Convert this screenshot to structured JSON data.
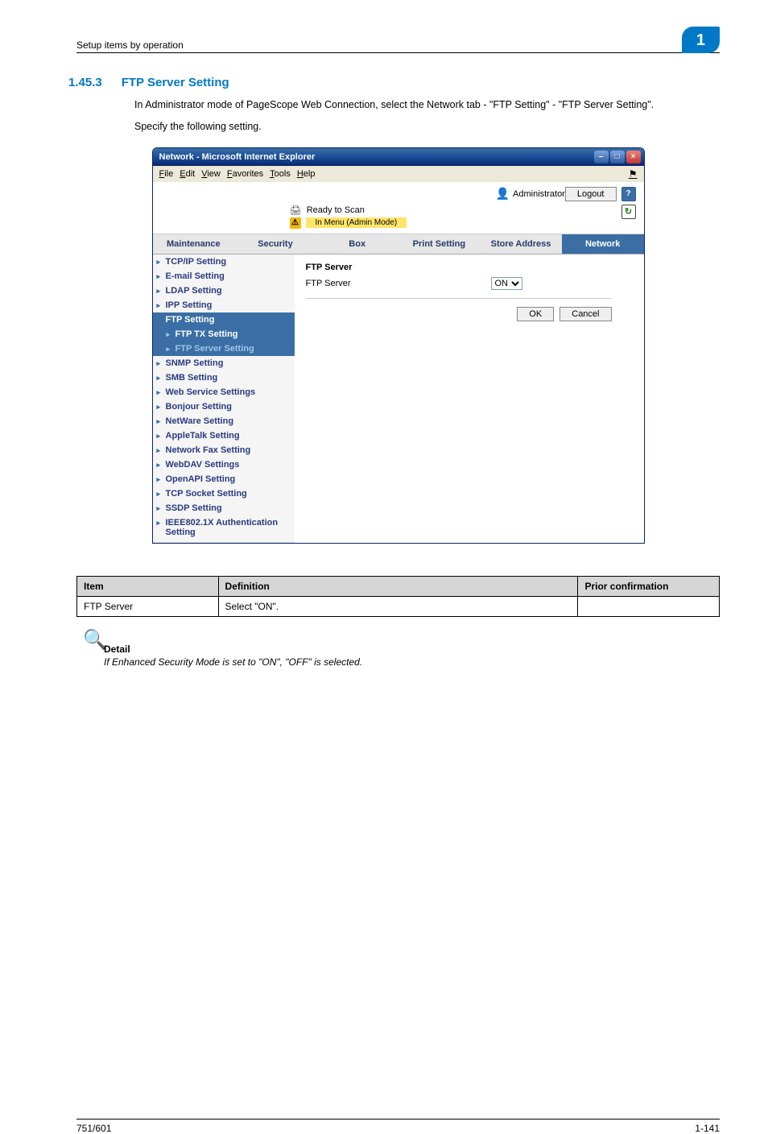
{
  "header": {
    "section_path": "Setup items by operation",
    "chapter_badge": "1"
  },
  "section": {
    "number": "1.45.3",
    "title": "FTP Server Setting",
    "para1": "In Administrator mode of PageScope Web Connection, select the Network tab - \"FTP Setting\" - \"FTP Server Setting\".",
    "para2": "Specify the following setting."
  },
  "window": {
    "title": "Network - Microsoft Internet Explorer",
    "menu": {
      "file": "File",
      "edit": "Edit",
      "view": "View",
      "favorites": "Favorites",
      "tools": "Tools",
      "help": "Help"
    },
    "admin_label": "Administrator",
    "logout": "Logout",
    "help_glyph": "?",
    "status": {
      "ready": "Ready to Scan",
      "mode": "In Menu (Admin Mode)"
    },
    "tabs": {
      "maintenance": "Maintenance",
      "security": "Security",
      "box": "Box",
      "print": "Print Setting",
      "store": "Store Address",
      "network": "Network"
    },
    "sidenav": {
      "tcpip": "TCP/IP Setting",
      "email": "E-mail Setting",
      "ldap": "LDAP Setting",
      "ipp": "IPP Setting",
      "ftp": "FTP Setting",
      "ftp_tx": "FTP TX Setting",
      "ftp_server": "FTP Server Setting",
      "snmp": "SNMP Setting",
      "smb": "SMB Setting",
      "webservice": "Web Service Settings",
      "bonjour": "Bonjour Setting",
      "netware": "NetWare Setting",
      "appletalk": "AppleTalk Setting",
      "netfax": "Network Fax Setting",
      "webdav": "WebDAV Settings",
      "openapi": "OpenAPI Setting",
      "tcpsocket": "TCP Socket Setting",
      "ssdp": "SSDP Setting",
      "ieee": "IEEE802.1X Authentication Setting"
    },
    "main": {
      "panel_title": "FTP Server",
      "field_label": "FTP Server",
      "selected_value": "ON",
      "ok": "OK",
      "cancel": "Cancel"
    }
  },
  "def_table": {
    "h_item": "Item",
    "h_def": "Definition",
    "h_prior": "Prior confirmation",
    "row_item": "FTP Server",
    "row_def": "Select \"ON\".",
    "row_prior": ""
  },
  "detail": {
    "heading": "Detail",
    "body": "If Enhanced Security Mode is set to \"ON\", \"OFF\" is selected."
  },
  "footer": {
    "left": "751/601",
    "right": "1-141"
  }
}
